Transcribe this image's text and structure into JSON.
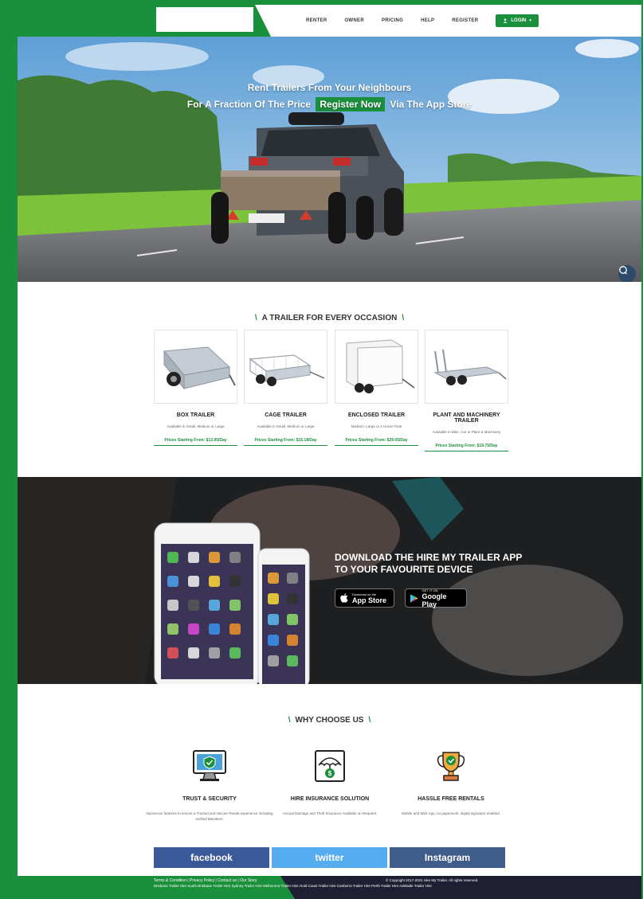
{
  "nav": {
    "items": [
      "RENTER",
      "OWNER",
      "PRICING",
      "HELP",
      "REGISTER"
    ],
    "login_label": "LOGIN"
  },
  "hero": {
    "line1": "Rent Trailers From Your Neighbours",
    "line2_before": "For A Fraction Of The Price",
    "register_label": "Register Now",
    "line2_after": "Via The App Store"
  },
  "trailers_section": {
    "title": "A TRAILER FOR EVERY OCCASION",
    "items": [
      {
        "name": "BOX TRAILER",
        "desc": "Available in Small, Medium or Large",
        "price": "Prices Starting From: $13.95/Day"
      },
      {
        "name": "CAGE TRAILER",
        "desc": "Available in Small, Medium or Large",
        "price": "Prices Starting From: $15.18/Day"
      },
      {
        "name": "ENCLOSED TRAILER",
        "desc": "Medium, Large or 2 Horse Float",
        "price": "Prices Starting From: $29.05/Day"
      },
      {
        "name": "PLANT AND MACHINERY TRAILER",
        "desc": "Available in Bike, Car or Plant & Machinery",
        "price": "Prices Starting From: $19.75/Day"
      }
    ]
  },
  "app_section": {
    "title_line1": "DOWNLOAD THE HIRE MY TRAILER APP",
    "title_line2": "TO YOUR FAVOURITE DEVICE",
    "appstore_small": "Download on the",
    "appstore_big": "App Store",
    "googleplay_small": "GET IT ON",
    "googleplay_big": "Google Play"
  },
  "why_section": {
    "title": "WHY CHOOSE US",
    "features": [
      {
        "title": "TRUST & SECURITY",
        "desc": "Numerous features to ensure a Trusted and Secure Rental experience including verified Members."
      },
      {
        "title": "HIRE INSURANCE SOLUTION",
        "desc": "Annual Damage and Theft Insurance Available on Request."
      },
      {
        "title": "HASSLE FREE RENTALS",
        "desc": "Mobile and Web App, no paperwork, digital signature enabled."
      }
    ]
  },
  "social": {
    "facebook": "facebook",
    "twitter": "twitter",
    "instagram": "Instagram"
  },
  "footer": {
    "links": "Terms & Condition | Privacy Policy | Contact us | Our Story",
    "cities": "Brisbane Trailer Hire  South Brisbane Trailer Hire  Sydney Trailer Hire  Melbourne Trailer Hire  Gold Coast Trailer Hire  Canberra Trailer Hire  Perth Trailer Hire  Adelaide Trailer Hire",
    "copyright": "© Copyright 2017-2021 Hire My Trailer. All rights reserved."
  },
  "colors": {
    "brand_green": "#1a8f3c",
    "footer_dark": "#1f1f33",
    "facebook": "#3b5998",
    "twitter": "#55acee",
    "instagram": "#3f5c8a"
  }
}
